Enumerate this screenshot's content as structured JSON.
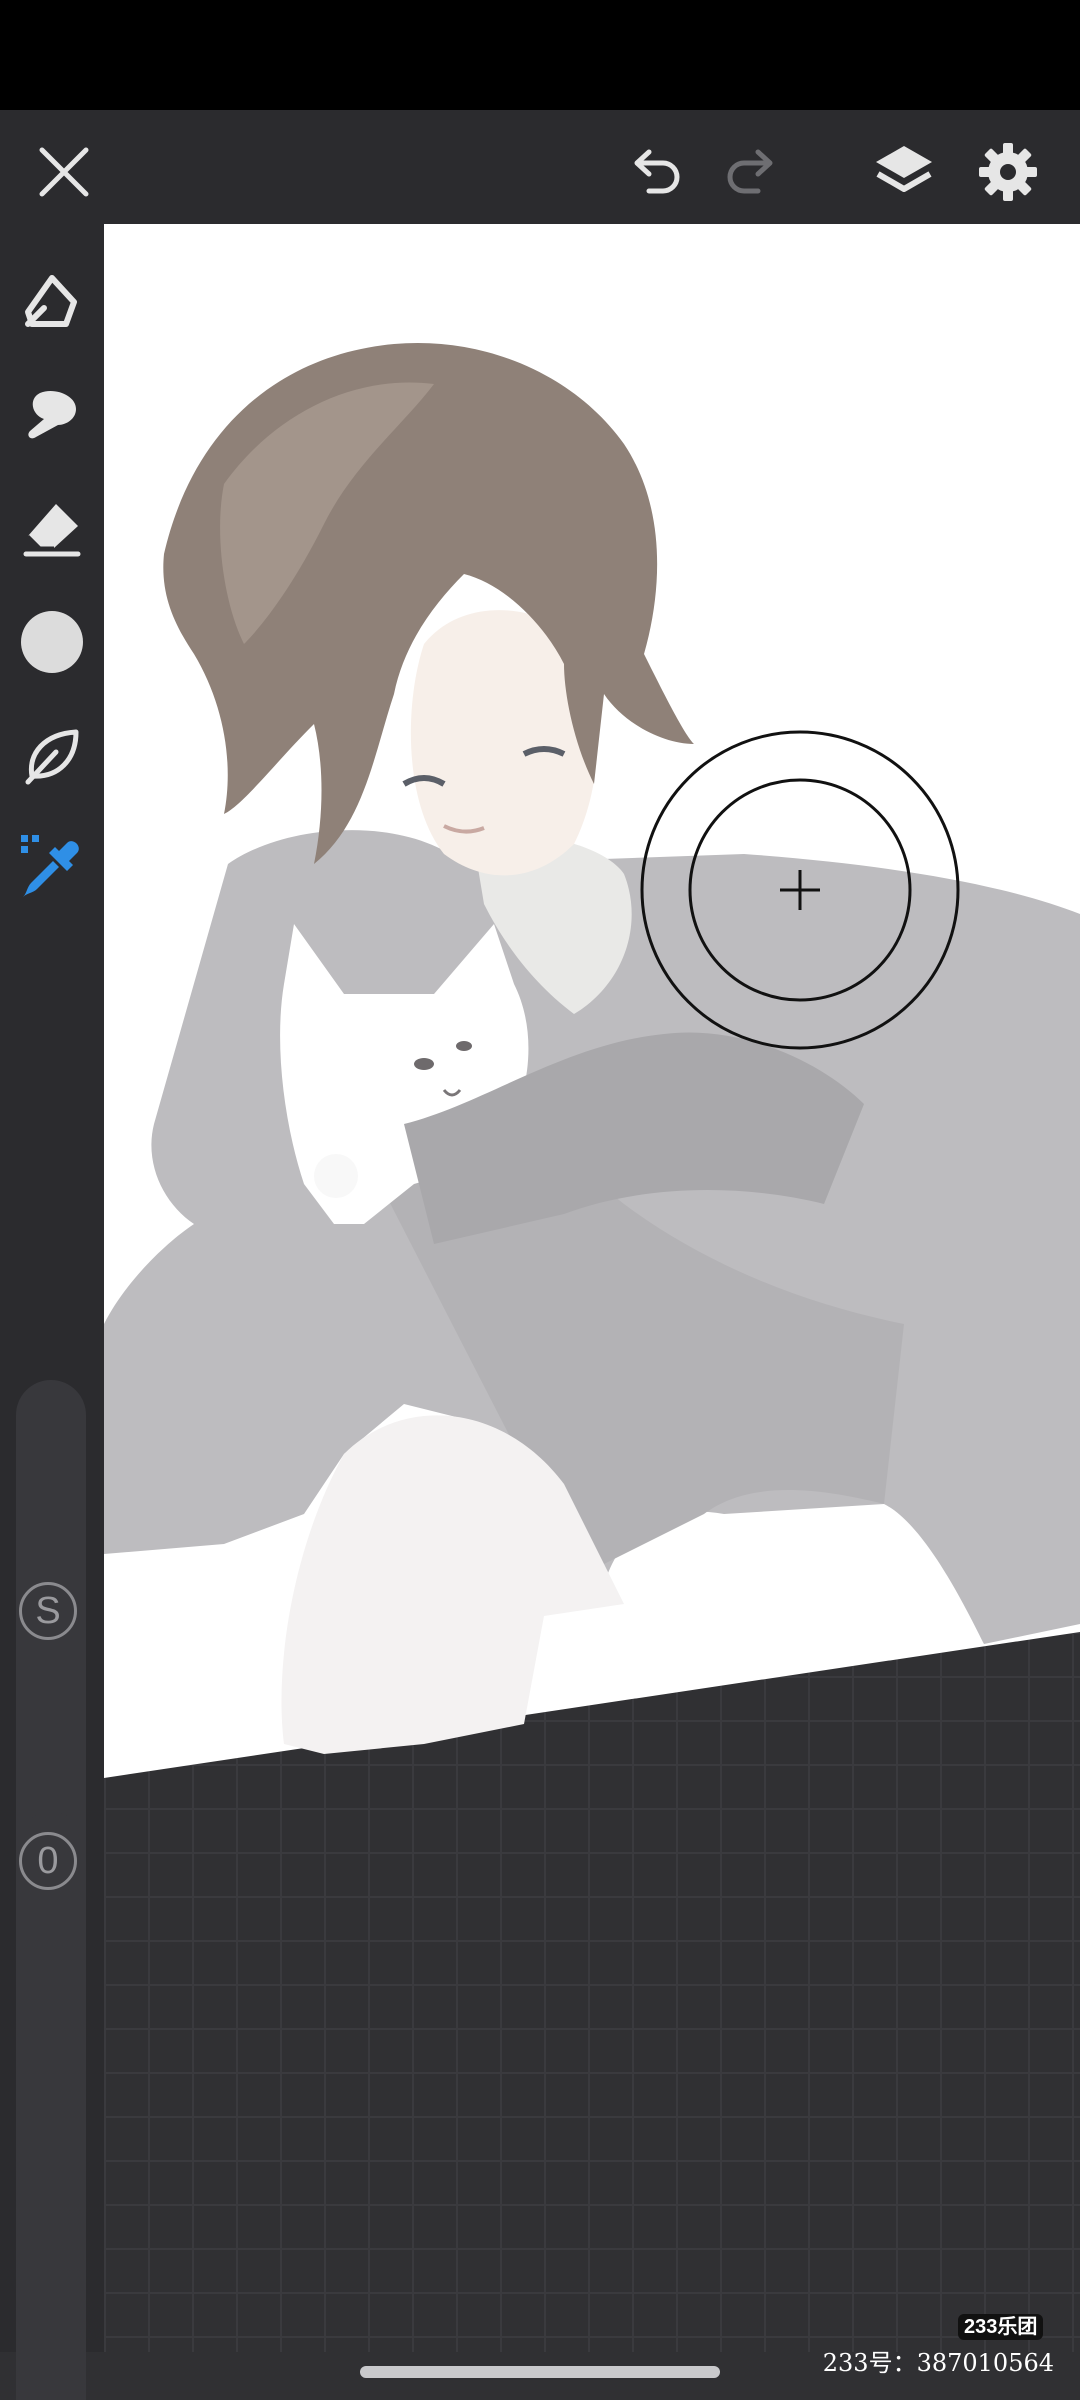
{
  "toolbar": {
    "close": "close-icon",
    "undo": "undo-icon",
    "redo": "redo-icon",
    "layers": "layers-icon",
    "settings": "gear-icon"
  },
  "tools": [
    {
      "name": "pen",
      "icon": "pen-nib-icon",
      "active": false
    },
    {
      "name": "smudge",
      "icon": "smudge-icon",
      "active": false
    },
    {
      "name": "eraser",
      "icon": "eraser-icon",
      "active": false
    },
    {
      "name": "color",
      "icon": "color-swatch-icon",
      "active": false
    },
    {
      "name": "lasso",
      "icon": "leaf-lasso-icon",
      "active": false
    },
    {
      "name": "eyedropper",
      "icon": "eyedropper-icon",
      "active": true
    }
  ],
  "sliders": {
    "size_label": "S",
    "opacity_label": "0"
  },
  "colors": {
    "accent": "#2f8fe6",
    "toolbar_bg": "#2b2b2e",
    "icon": "#e6e6e6",
    "canvas": "#ffffff"
  },
  "watermark": {
    "logo": "233乐团",
    "id_text": "233号：387010564"
  }
}
